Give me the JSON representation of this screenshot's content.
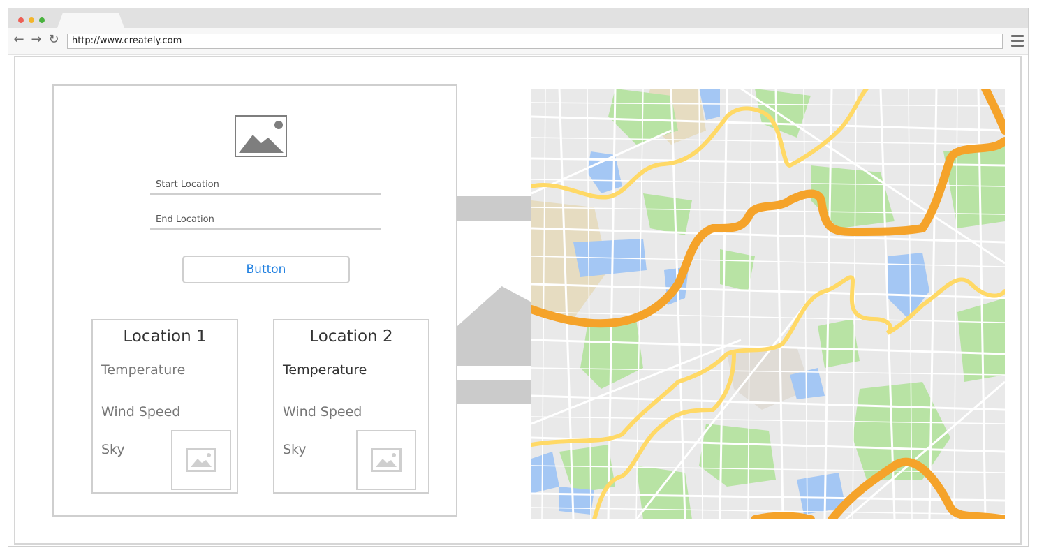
{
  "browser": {
    "url": "http://www.creately.com",
    "dot_colors": [
      "#ed5f55",
      "#f3b52b",
      "#49b23e"
    ],
    "icons": [
      "back-arrow-icon",
      "forward-arrow-icon",
      "reload-icon",
      "hamburger-menu-icon"
    ]
  },
  "form": {
    "logo_icon": "image-placeholder-icon",
    "start_placeholder": "Start Location",
    "end_placeholder": "End Location",
    "button_label": "Button"
  },
  "cards": [
    {
      "title": "Location 1",
      "temperature_label": "Temperature",
      "wind_label": "Wind Speed",
      "sky_label": "Sky",
      "image_icon": "image-placeholder-icon"
    },
    {
      "title": "Location 2",
      "temperature_label": "Temperature",
      "wind_label": "Wind Speed",
      "sky_label": "Sky",
      "image_icon": "image-placeholder-icon"
    }
  ],
  "map": {
    "colors": {
      "land": "#e9e9e9",
      "park": "#b8e3a4",
      "water": "#a4c7f4",
      "sand": "#e6dcc1",
      "highway": "#f5a32a",
      "road": "#ffd966",
      "street": "#ffffff"
    }
  }
}
